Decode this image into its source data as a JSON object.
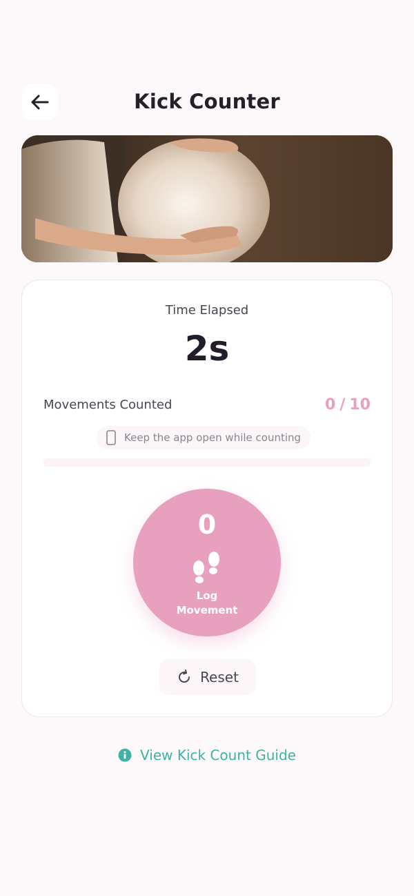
{
  "header": {
    "title": "Kick Counter",
    "back_icon": "arrow-left-icon"
  },
  "hero": {
    "image": "pregnant-belly-photo"
  },
  "timer": {
    "label": "Time Elapsed",
    "value": "2s"
  },
  "movements": {
    "label": "Movements Counted",
    "count": "0",
    "separator": "/",
    "goal": "10",
    "progress": 0
  },
  "hint": {
    "icon": "phone-icon",
    "text": "Keep the app open while counting"
  },
  "log_button": {
    "count": "0",
    "icon": "footprints-icon",
    "label_line1": "Log",
    "label_line2": "Movement"
  },
  "reset": {
    "icon": "refresh-icon",
    "label": "Reset"
  },
  "guide": {
    "icon": "info-icon",
    "label": "View Kick Count Guide"
  },
  "colors": {
    "background": "#fdf8f9",
    "accent_pink": "#e8a0bf",
    "accent_teal": "#3fb2a6",
    "text_dark": "#241f2b"
  }
}
